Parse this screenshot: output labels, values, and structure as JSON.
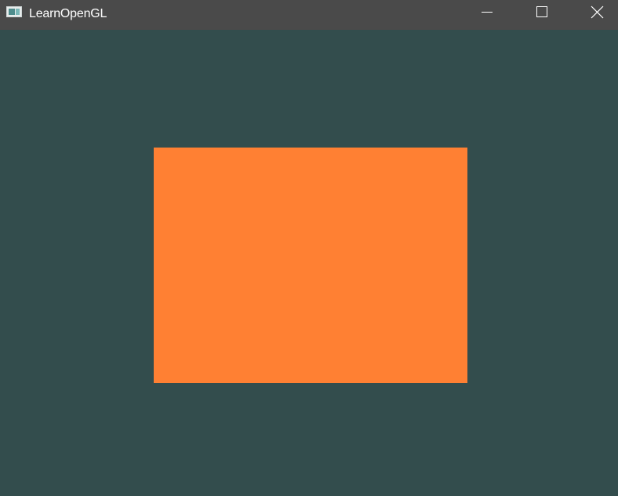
{
  "window": {
    "title": "LearnOpenGL",
    "titlebar_color": "#4a4a4a",
    "clear_color": "#334d4d",
    "controls": {
      "minimize_icon": "minimize-icon",
      "maximize_icon": "maximize-icon",
      "close_icon": "close-icon"
    }
  },
  "scene": {
    "shape": "rectangle",
    "fill_color": "#ff8033"
  }
}
